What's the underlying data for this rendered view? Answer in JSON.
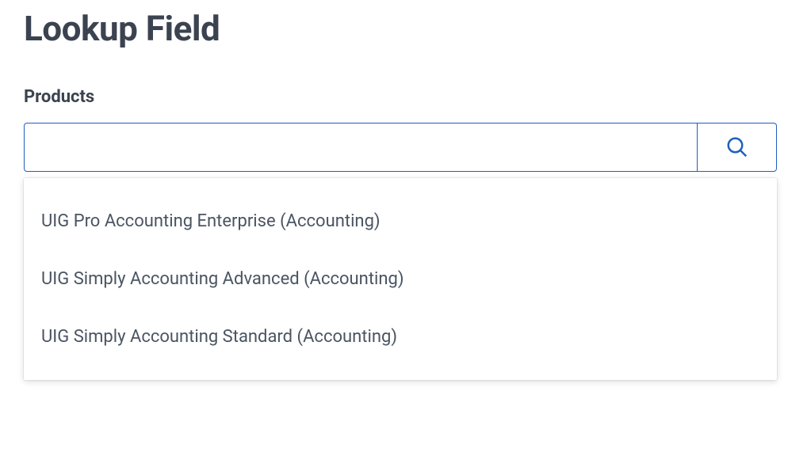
{
  "page": {
    "title": "Lookup Field"
  },
  "field": {
    "label": "Products",
    "value": "",
    "placeholder": ""
  },
  "dropdown": {
    "items": [
      {
        "label": "UIG Pro Accounting Enterprise (Accounting)"
      },
      {
        "label": "UIG Simply Accounting Advanced (Accounting)"
      },
      {
        "label": "UIG Simply Accounting Standard (Accounting)"
      }
    ]
  }
}
